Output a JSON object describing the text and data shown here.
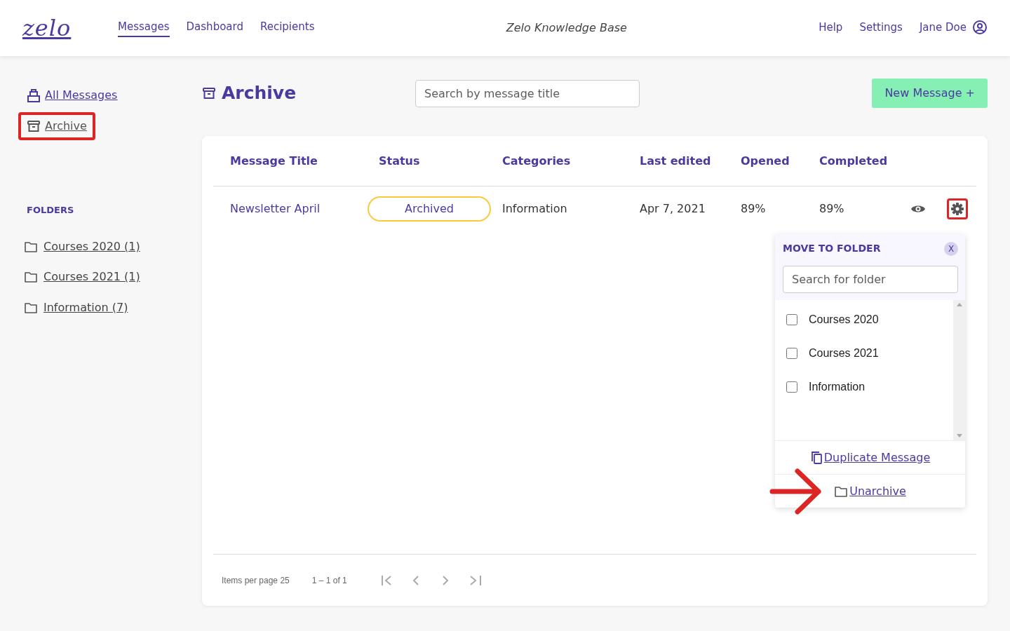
{
  "navbar": {
    "logo": "zelo",
    "links": [
      {
        "label": "Messages",
        "selected": true
      },
      {
        "label": "Dashboard",
        "selected": false
      },
      {
        "label": "Recipients",
        "selected": false
      }
    ],
    "center_title": "Zelo Knowledge Base",
    "right_links": [
      "Help",
      "Settings"
    ],
    "user": "Jane Doe"
  },
  "sidebar": {
    "items": [
      {
        "label": "All Messages",
        "selected": false,
        "annotated": false
      },
      {
        "label": "Archive",
        "selected": true,
        "annotated": true
      }
    ],
    "folders_heading": "FOLDERS",
    "folders": [
      "Courses 2020 (1)",
      "Courses 2021 (1)",
      "Information (7)"
    ]
  },
  "page": {
    "title": "Archive",
    "search_placeholder": "Search by message title",
    "new_button": "New Message +"
  },
  "table": {
    "columns": [
      "Message Title",
      "Status",
      "Categories",
      "Last edited",
      "Opened",
      "Completed"
    ],
    "rows": [
      {
        "title": "Newsletter April",
        "status": "Archived",
        "category": "Information",
        "last_edited": "Apr 7, 2021",
        "opened": "89%",
        "completed": "89%",
        "settings_annotated": true
      }
    ]
  },
  "popup": {
    "title": "MOVE TO FOLDER",
    "close": "X",
    "search_placeholder": "Search for folder",
    "options": [
      {
        "label": "Courses 2020",
        "checked": false
      },
      {
        "label": "Courses 2021",
        "checked": false
      },
      {
        "label": "Information",
        "checked": false
      }
    ],
    "actions": [
      {
        "label": "Duplicate Message",
        "kind": "duplicate",
        "annotated": false
      },
      {
        "label": "Unarchive",
        "kind": "unarchive",
        "annotated": true
      }
    ]
  },
  "pagination": {
    "items_per_page": "Items per page 25",
    "range": "1 – 1 of 1"
  }
}
